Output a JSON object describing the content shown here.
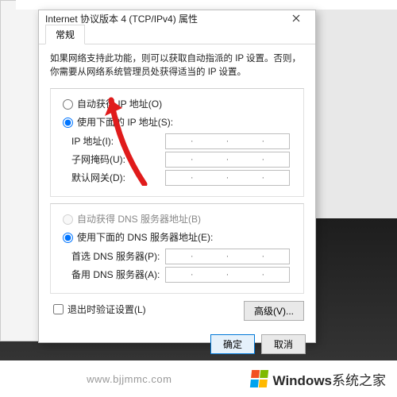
{
  "window": {
    "title": "Internet 协议版本 4 (TCP/IPv4) 属性"
  },
  "tab": {
    "general": "常规"
  },
  "description": "如果网络支持此功能，则可以获取自动指派的 IP 设置。否则，你需要从网络系统管理员处获得适当的 IP 设置。",
  "ip": {
    "auto": "自动获得 IP 地址(O)",
    "manual": "使用下面的 IP 地址(S):",
    "addr": "IP 地址(I):",
    "mask": "子网掩码(U):",
    "gateway": "默认网关(D):"
  },
  "dns": {
    "auto": "自动获得 DNS 服务器地址(B)",
    "manual": "使用下面的 DNS 服务器地址(E):",
    "pref": "首选 DNS 服务器(P):",
    "alt": "备用 DNS 服务器(A):"
  },
  "validate": "退出时验证设置(L)",
  "buttons": {
    "advanced": "高级(V)...",
    "ok": "确定",
    "cancel": "取消"
  },
  "footer": {
    "url": "www.bjjmmc.com",
    "brand_prefix": "Windows",
    "brand_suffix": "系统之家"
  }
}
